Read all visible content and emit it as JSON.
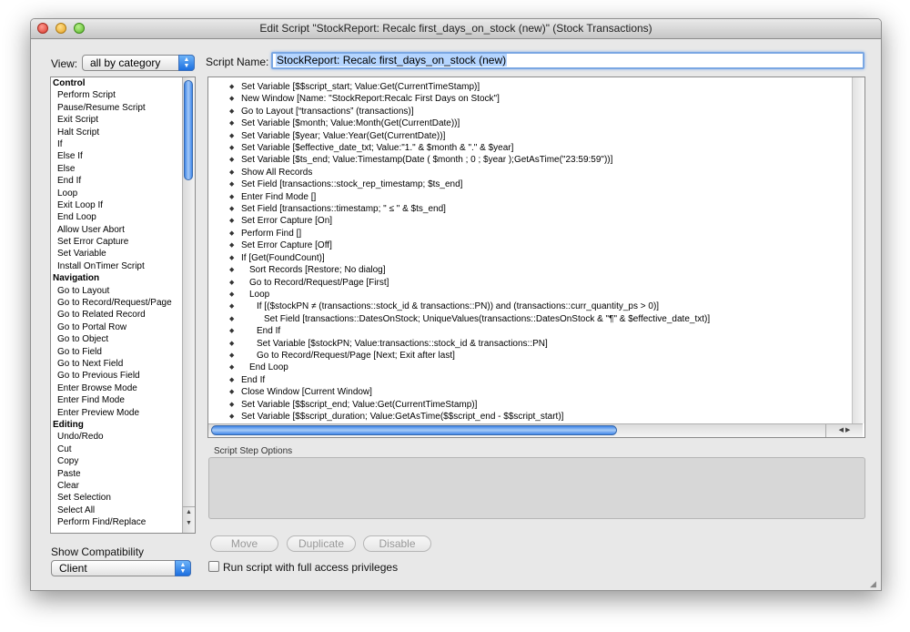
{
  "window": {
    "title": "Edit Script \"StockReport: Recalc first_days_on_stock (new)\" (Stock Transactions)"
  },
  "view": {
    "label": "View:",
    "value": "all by category"
  },
  "script_name": {
    "label": "Script Name:",
    "value": "StockReport: Recalc first_days_on_stock (new)"
  },
  "step_list": [
    {
      "label": "Control",
      "category": true
    },
    {
      "label": "Perform Script"
    },
    {
      "label": "Pause/Resume Script"
    },
    {
      "label": "Exit Script"
    },
    {
      "label": "Halt Script"
    },
    {
      "label": "If"
    },
    {
      "label": "Else If"
    },
    {
      "label": "Else"
    },
    {
      "label": "End If"
    },
    {
      "label": "Loop"
    },
    {
      "label": "Exit Loop If"
    },
    {
      "label": "End Loop"
    },
    {
      "label": "Allow User Abort"
    },
    {
      "label": "Set Error Capture"
    },
    {
      "label": "Set Variable"
    },
    {
      "label": "Install OnTimer Script"
    },
    {
      "label": "Navigation",
      "category": true
    },
    {
      "label": "Go to Layout"
    },
    {
      "label": "Go to Record/Request/Page"
    },
    {
      "label": "Go to Related Record"
    },
    {
      "label": "Go to Portal Row"
    },
    {
      "label": "Go to Object"
    },
    {
      "label": "Go to Field"
    },
    {
      "label": "Go to Next Field"
    },
    {
      "label": "Go to Previous Field"
    },
    {
      "label": "Enter Browse Mode"
    },
    {
      "label": "Enter Find Mode"
    },
    {
      "label": "Enter Preview Mode"
    },
    {
      "label": "Editing",
      "category": true
    },
    {
      "label": "Undo/Redo"
    },
    {
      "label": "Cut"
    },
    {
      "label": "Copy"
    },
    {
      "label": "Paste"
    },
    {
      "label": "Clear"
    },
    {
      "label": "Set Selection"
    },
    {
      "label": "Select All"
    },
    {
      "label": "Perform Find/Replace"
    }
  ],
  "script_lines": [
    {
      "indent": 0,
      "text": "Set Variable [$$script_start; Value:Get(CurrentTimeStamp)]"
    },
    {
      "indent": 0,
      "text": "New Window [Name: \"StockReport:Recalc First Days on Stock\"]"
    },
    {
      "indent": 0,
      "text": "Go to Layout [“transactions” (transactions)]"
    },
    {
      "indent": 0,
      "text": "Set Variable [$month; Value:Month(Get(CurrentDate))]"
    },
    {
      "indent": 0,
      "text": "Set Variable [$year; Value:Year(Get(CurrentDate))]"
    },
    {
      "indent": 0,
      "text": "Set Variable [$effective_date_txt; Value:\"1.\" & $month & \".\" & $year]"
    },
    {
      "indent": 0,
      "text": "Set Variable [$ts_end; Value:Timestamp(Date ( $month ; 0 ; $year );GetAsTime(\"23:59:59\"))]"
    },
    {
      "indent": 0,
      "text": "Show All Records"
    },
    {
      "indent": 0,
      "text": "Set Field [transactions::stock_rep_timestamp; $ts_end]"
    },
    {
      "indent": 0,
      "text": "Enter Find Mode []"
    },
    {
      "indent": 0,
      "text": "Set Field [transactions::timestamp; \" ≤ \" & $ts_end]"
    },
    {
      "indent": 0,
      "text": "Set Error Capture [On]"
    },
    {
      "indent": 0,
      "text": "Perform Find []"
    },
    {
      "indent": 0,
      "text": "Set Error Capture [Off]"
    },
    {
      "indent": 0,
      "text": "If [Get(FoundCount)]"
    },
    {
      "indent": 1,
      "text": "Sort Records [Restore; No dialog]"
    },
    {
      "indent": 1,
      "text": "Go to Record/Request/Page [First]"
    },
    {
      "indent": 1,
      "text": "Loop"
    },
    {
      "indent": 2,
      "text": "If [($stockPN  ≠ (transactions::stock_id & transactions::PN)) and (transactions::curr_quantity_ps > 0)]"
    },
    {
      "indent": 3,
      "text": "Set Field [transactions::DatesOnStock; UniqueValues(transactions::DatesOnStock & \"¶\" & $effective_date_txt)]"
    },
    {
      "indent": 2,
      "text": "End If"
    },
    {
      "indent": 2,
      "text": "Set Variable [$stockPN; Value:transactions::stock_id & transactions::PN]"
    },
    {
      "indent": 2,
      "text": "Go to Record/Request/Page [Next; Exit after last]"
    },
    {
      "indent": 1,
      "text": "End Loop"
    },
    {
      "indent": 0,
      "text": "End If"
    },
    {
      "indent": 0,
      "text": "Close Window [Current Window]"
    },
    {
      "indent": 0,
      "text": "Set Variable [$$script_end; Value:Get(CurrentTimeStamp)]"
    },
    {
      "indent": 0,
      "text": "Set Variable [$$script_duration; Value:GetAsTime($$script_end - $$script_start)]"
    }
  ],
  "script_step_options": {
    "label": "Script Step Options"
  },
  "buttons": {
    "move": "Move",
    "duplicate": "Duplicate",
    "disable": "Disable"
  },
  "compatibility": {
    "label": "Show Compatibility",
    "value": "Client"
  },
  "full_access": {
    "label": "Run script with full access privileges",
    "checked": false
  }
}
